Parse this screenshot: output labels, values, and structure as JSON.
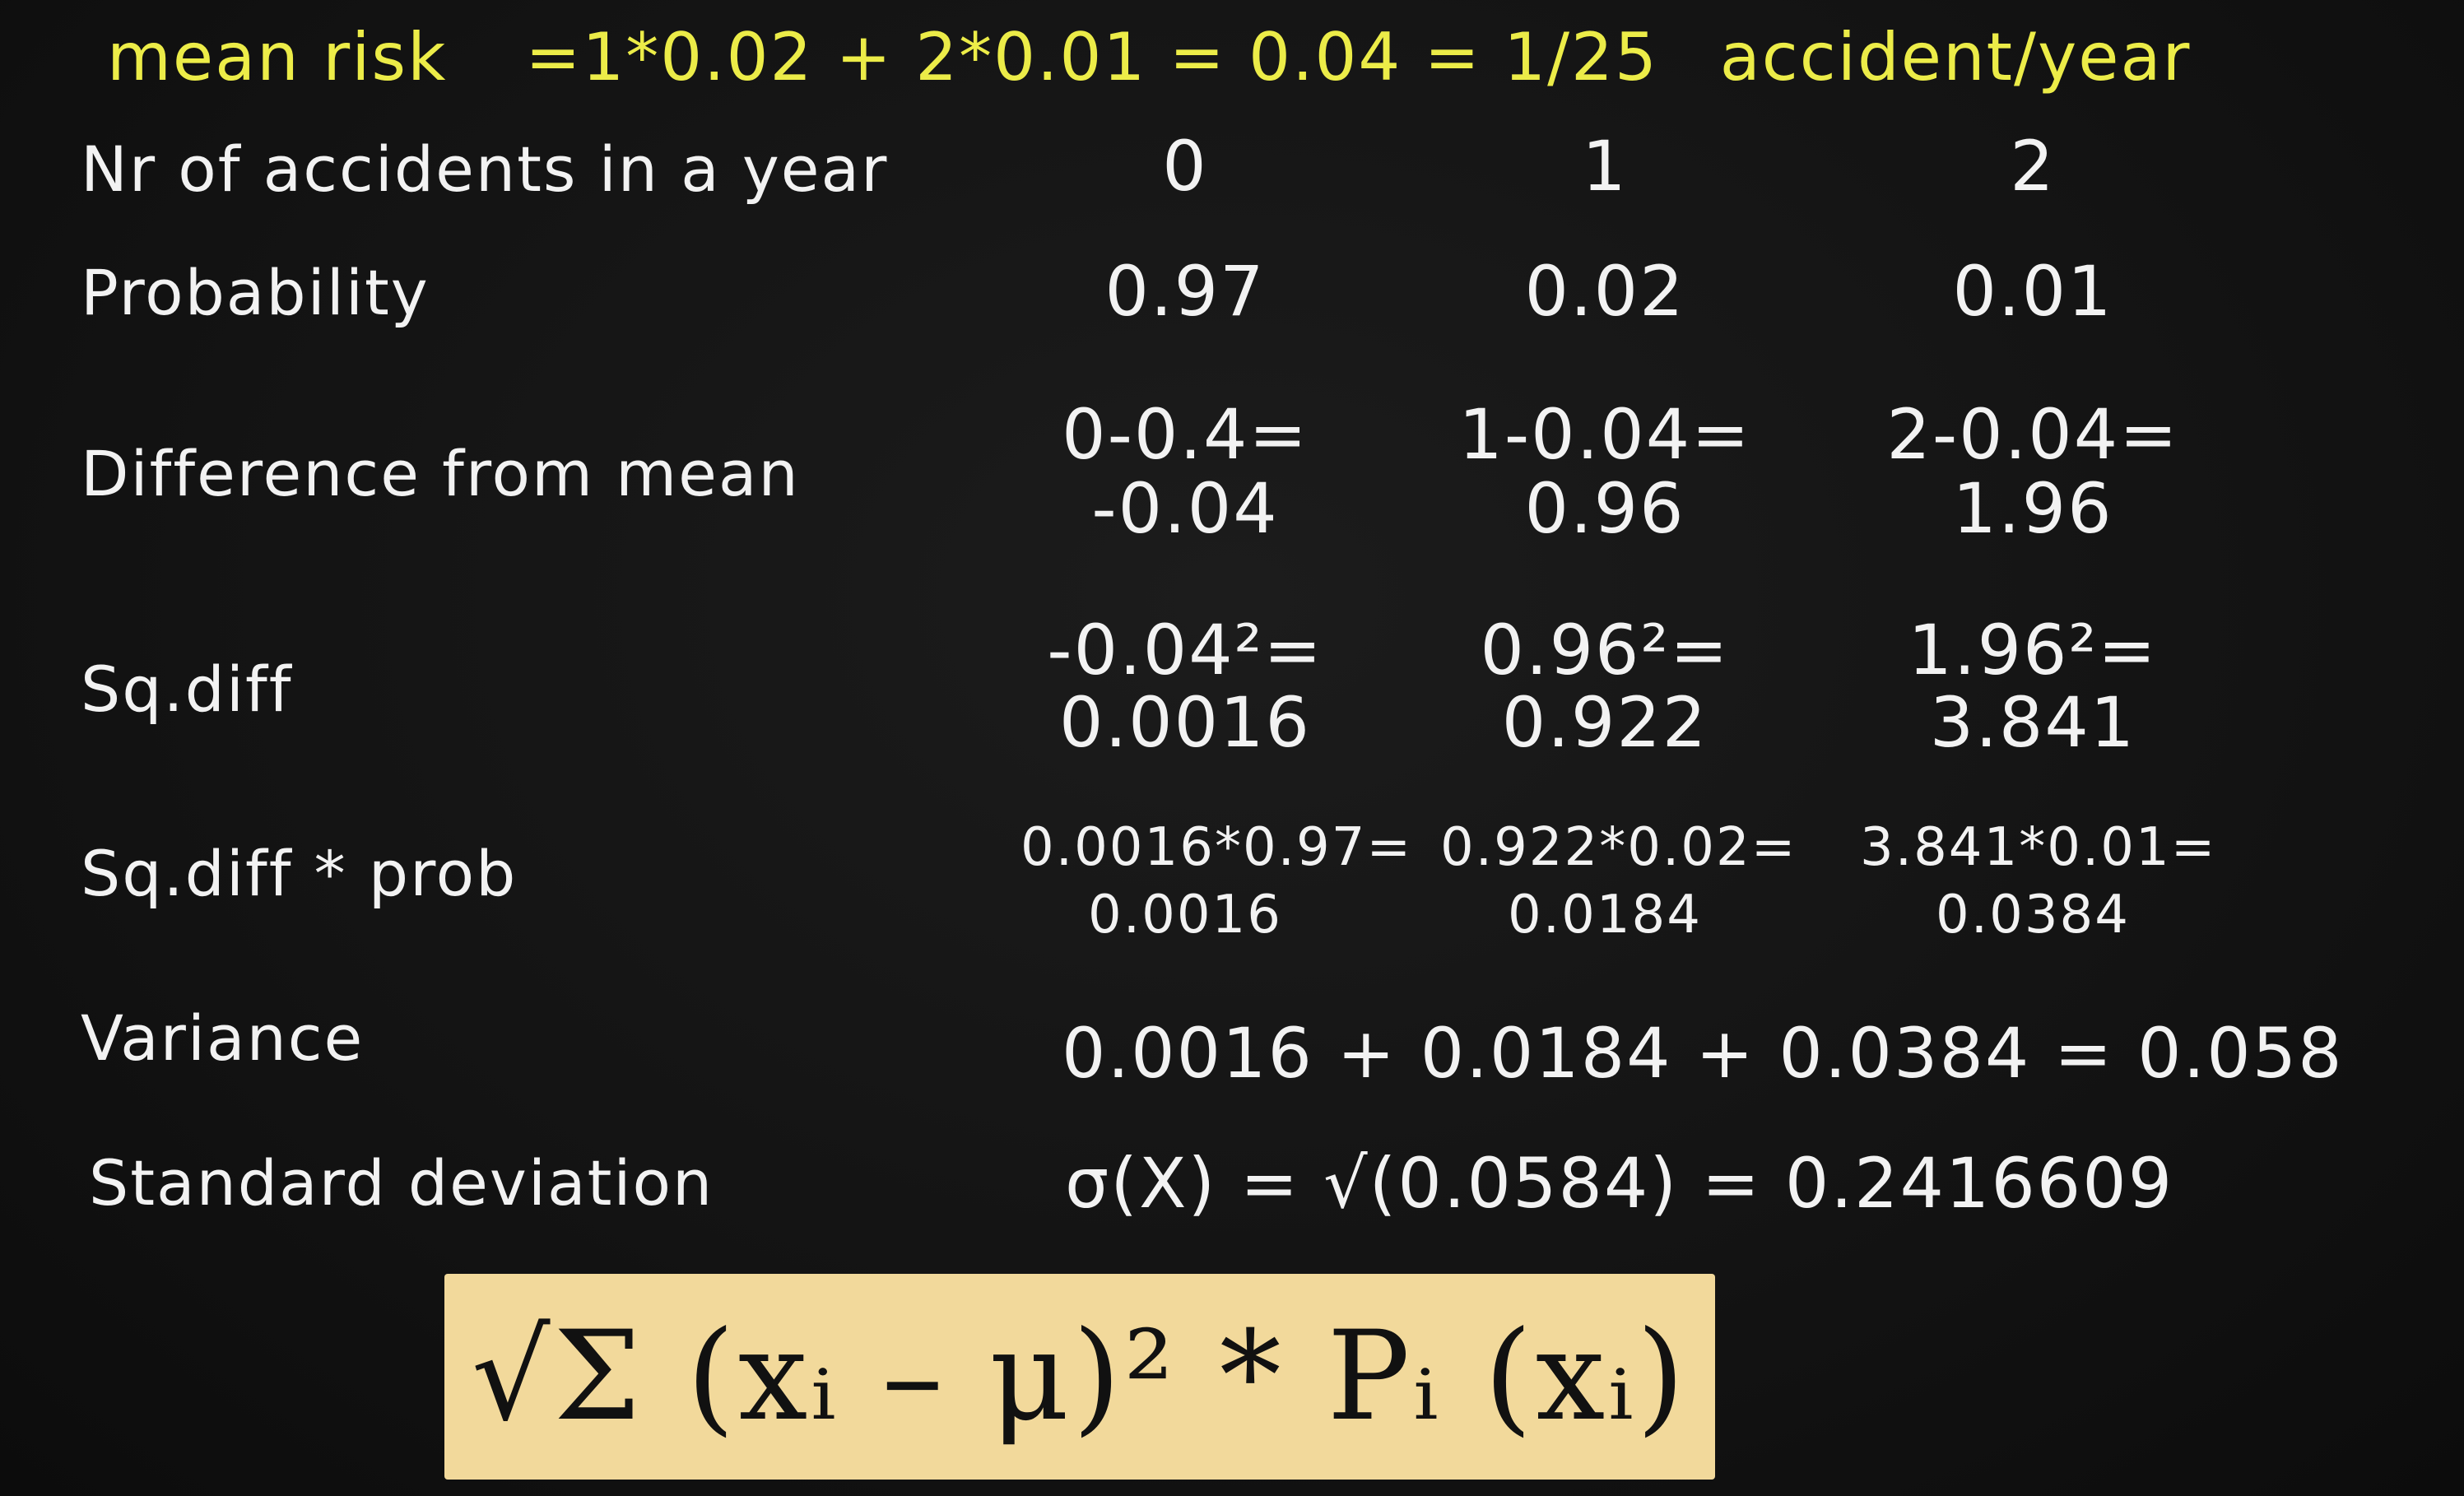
{
  "header": {
    "mean_risk_label": "mean risk",
    "mean_risk_formula": "=1*0.02 + 2*0.01 = 0.04 = 1/25",
    "mean_risk_unit": "accident/year"
  },
  "rows": {
    "accidents": {
      "label": "Nr of accidents in a year",
      "values": [
        "0",
        "1",
        "2"
      ]
    },
    "probability": {
      "label": "Probability",
      "values": [
        "0.97",
        "0.02",
        "0.01"
      ]
    },
    "difference": {
      "label": "Difference from mean",
      "line1": [
        "0-0.4=",
        "1-0.04=",
        "2-0.04="
      ],
      "line2": [
        "-0.04",
        "0.96",
        "1.96"
      ]
    },
    "sq_diff": {
      "label": "Sq.diff",
      "line1": [
        "-0.04²=",
        "0.96²=",
        "1.96²="
      ],
      "line2": [
        "0.0016",
        "0.922",
        "3.841"
      ]
    },
    "sq_diff_prob": {
      "label": "Sq.diff * prob",
      "line1": [
        "0.0016*0.97=",
        "0.922*0.02=",
        "3.841*0.01="
      ],
      "line2": [
        "0.0016",
        "0.0184",
        "0.0384"
      ]
    },
    "variance": {
      "label": "Variance",
      "expression": "0.0016 + 0.0184 + 0.0384 = 0.058"
    },
    "std_dev": {
      "label": "Standard deviation",
      "expression": "σ(X) = √(0.0584) = 0.2416609"
    }
  },
  "formula": {
    "text": "√Σ (xᵢ – μ)² * Pᵢ (xᵢ)"
  },
  "colors": {
    "background": "#141414",
    "chalk_white": "#f2f2f2",
    "chalk_yellow": "#ecec48",
    "formula_box": "#f2d99b"
  }
}
